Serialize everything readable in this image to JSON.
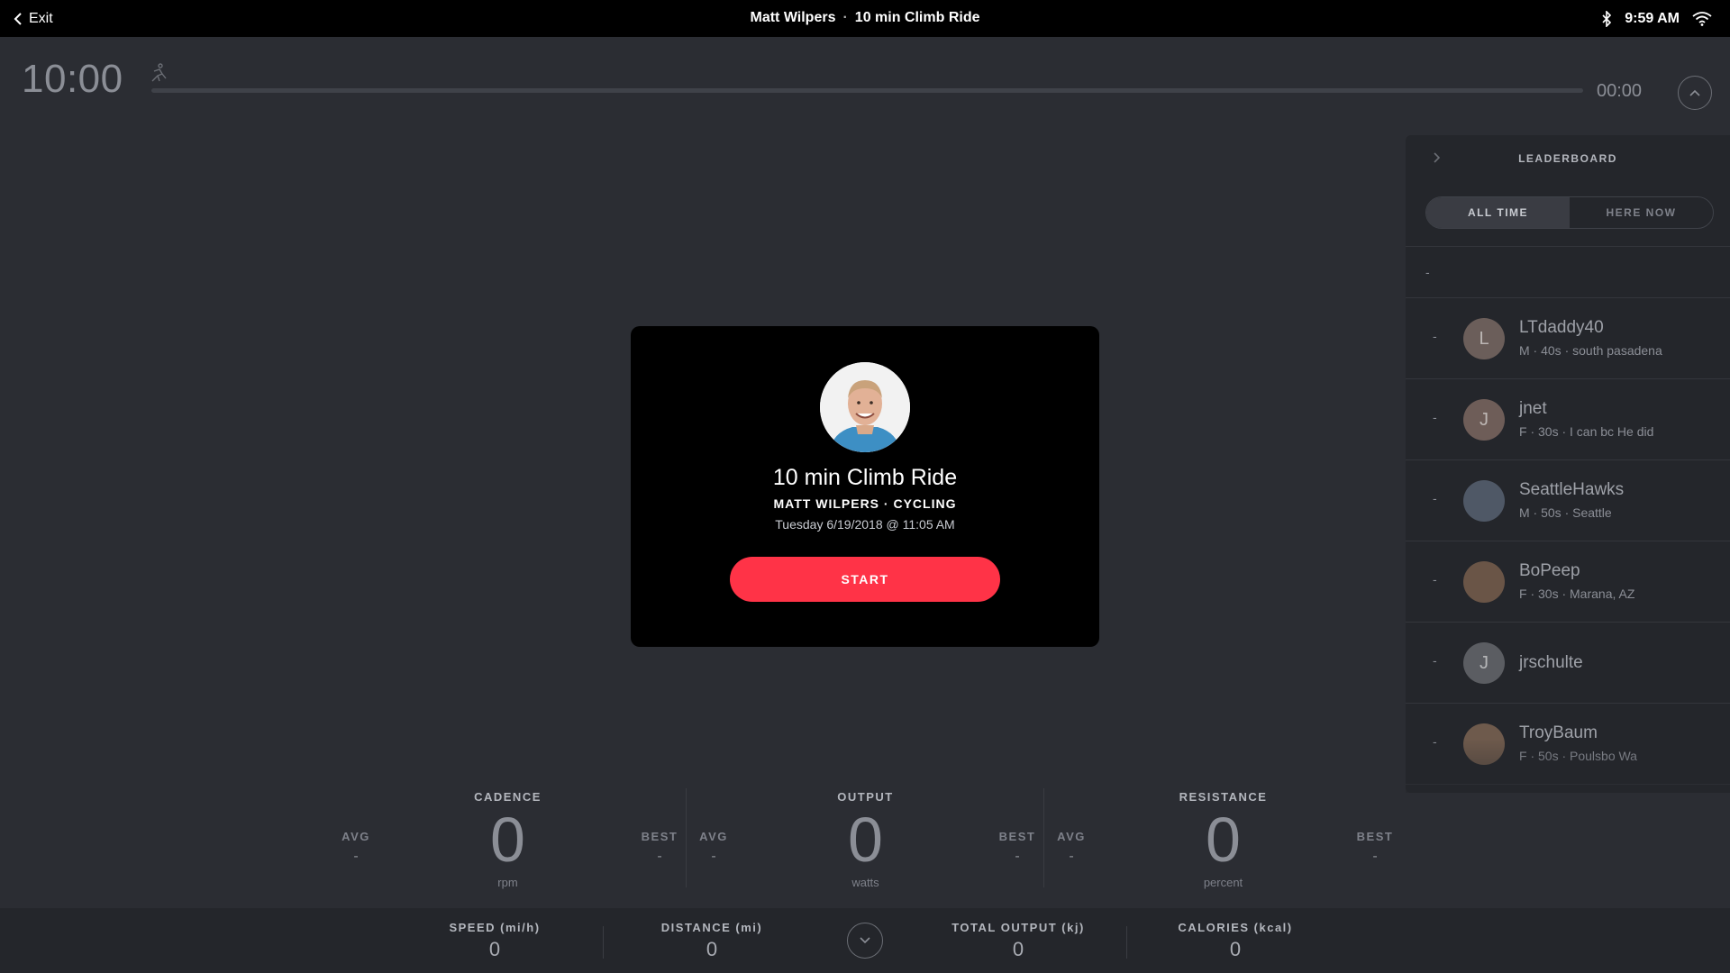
{
  "topbar": {
    "exit_label": "Exit",
    "instructor": "Matt Wilpers",
    "separator": "·",
    "class_title": "10 min Climb Ride",
    "time": "9:59 AM"
  },
  "timer": {
    "elapsed": "10:00",
    "remaining": "00:00",
    "progress_fraction": 0
  },
  "leaderboard": {
    "title": "LEADERBOARD",
    "tabs": [
      {
        "label": "ALL TIME",
        "active": true
      },
      {
        "label": "HERE NOW",
        "active": false
      }
    ],
    "self_rank": "-",
    "riders": [
      {
        "rank": "-",
        "initial": "L",
        "name": "LTdaddy40",
        "meta": "M · 40s · south pasadena",
        "avatar_color": "#6b5e5a"
      },
      {
        "rank": "-",
        "initial": "J",
        "name": "jnet",
        "meta": "F · 30s · I can bc He did",
        "avatar_color": "#6e5d58"
      },
      {
        "rank": "-",
        "initial": "",
        "name": "SeattleHawks",
        "meta": "M · 50s · Seattle",
        "avatar_color": "#4f5866"
      },
      {
        "rank": "-",
        "initial": "",
        "name": "BoPeep",
        "meta": "F · 30s · Marana, AZ",
        "avatar_color": "#6a5547"
      },
      {
        "rank": "-",
        "initial": "J",
        "name": "jrschulte",
        "meta": "",
        "avatar_color": "#5b5d62"
      },
      {
        "rank": "-",
        "initial": "",
        "name": "TroyBaum",
        "meta": "F · 50s · Poulsbo Wa",
        "avatar_color": "#6e5a4c"
      }
    ]
  },
  "card": {
    "title": "10 min Climb Ride",
    "subtitle": "MATT WILPERS · CYCLING",
    "date": "Tuesday 6/19/2018 @ 11:05 AM",
    "start_label": "START"
  },
  "metrics": [
    {
      "label": "CADENCE",
      "value": "0",
      "unit": "rpm",
      "avg_label": "AVG",
      "avg": "-",
      "best_label": "BEST",
      "best": "-"
    },
    {
      "label": "OUTPUT",
      "value": "0",
      "unit": "watts",
      "avg_label": "AVG",
      "avg": "-",
      "best_label": "BEST",
      "best": "-"
    },
    {
      "label": "RESISTANCE",
      "value": "0",
      "unit": "percent",
      "avg_label": "AVG",
      "avg": "-",
      "best_label": "BEST",
      "best": "-"
    }
  ],
  "stats": [
    {
      "label": "SPEED (mi/h)",
      "value": "0"
    },
    {
      "label": "DISTANCE (mi)",
      "value": "0"
    },
    {
      "label": "TOTAL OUTPUT (kj)",
      "value": "0"
    },
    {
      "label": "CALORIES (kcal)",
      "value": "0"
    }
  ],
  "colors": {
    "accent": "#ff3347",
    "background": "#2b2d33",
    "topbar": "#000000"
  }
}
